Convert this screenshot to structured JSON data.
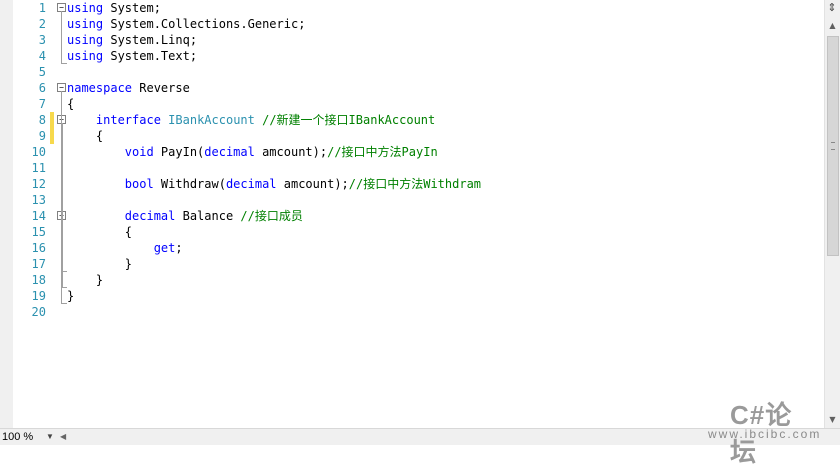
{
  "editor": {
    "lines": [
      {
        "num": "1",
        "parts": [
          {
            "t": "using",
            "c": "kw"
          },
          {
            "t": " System;",
            "c": ""
          }
        ]
      },
      {
        "num": "2",
        "parts": [
          {
            "t": "using",
            "c": "kw"
          },
          {
            "t": " System.Collections.Generic;",
            "c": ""
          }
        ]
      },
      {
        "num": "3",
        "parts": [
          {
            "t": "using",
            "c": "kw"
          },
          {
            "t": " System.Linq;",
            "c": ""
          }
        ]
      },
      {
        "num": "4",
        "parts": [
          {
            "t": "using",
            "c": "kw"
          },
          {
            "t": " System.Text;",
            "c": ""
          }
        ]
      },
      {
        "num": "5",
        "parts": []
      },
      {
        "num": "6",
        "parts": [
          {
            "t": "namespace",
            "c": "kw"
          },
          {
            "t": " Reverse",
            "c": ""
          }
        ]
      },
      {
        "num": "7",
        "parts": [
          {
            "t": "{",
            "c": ""
          }
        ]
      },
      {
        "num": "8",
        "parts": [
          {
            "t": "    ",
            "c": ""
          },
          {
            "t": "interface",
            "c": "kw"
          },
          {
            "t": " ",
            "c": ""
          },
          {
            "t": "IBankAccount",
            "c": "ty"
          },
          {
            "t": " //新建一个接口IBankAccount",
            "c": "cm"
          }
        ]
      },
      {
        "num": "9",
        "parts": [
          {
            "t": "    {",
            "c": ""
          }
        ]
      },
      {
        "num": "10",
        "parts": [
          {
            "t": "        ",
            "c": ""
          },
          {
            "t": "void",
            "c": "kw"
          },
          {
            "t": " PayIn(",
            "c": ""
          },
          {
            "t": "decimal",
            "c": "kw"
          },
          {
            "t": " amcount);",
            "c": ""
          },
          {
            "t": "//接口中方法PayIn",
            "c": "cm"
          }
        ]
      },
      {
        "num": "11",
        "parts": []
      },
      {
        "num": "12",
        "parts": [
          {
            "t": "        ",
            "c": ""
          },
          {
            "t": "bool",
            "c": "kw"
          },
          {
            "t": " Withdraw(",
            "c": ""
          },
          {
            "t": "decimal",
            "c": "kw"
          },
          {
            "t": " amcount);",
            "c": ""
          },
          {
            "t": "//接口中方法Withdram",
            "c": "cm"
          }
        ]
      },
      {
        "num": "13",
        "parts": []
      },
      {
        "num": "14",
        "parts": [
          {
            "t": "        ",
            "c": ""
          },
          {
            "t": "decimal",
            "c": "kw"
          },
          {
            "t": " Balance ",
            "c": ""
          },
          {
            "t": "//接口成员",
            "c": "cm"
          }
        ]
      },
      {
        "num": "15",
        "parts": [
          {
            "t": "        {",
            "c": ""
          }
        ]
      },
      {
        "num": "16",
        "parts": [
          {
            "t": "            ",
            "c": ""
          },
          {
            "t": "get",
            "c": "kw"
          },
          {
            "t": ";",
            "c": ""
          }
        ]
      },
      {
        "num": "17",
        "parts": [
          {
            "t": "        }",
            "c": ""
          }
        ]
      },
      {
        "num": "18",
        "parts": [
          {
            "t": "    }",
            "c": ""
          }
        ]
      },
      {
        "num": "19",
        "parts": [
          {
            "t": "}",
            "c": ""
          }
        ]
      },
      {
        "num": "20",
        "parts": []
      }
    ]
  },
  "status": {
    "zoom": "100 %"
  },
  "watermark": {
    "title": "C#论坛",
    "url": "www.ibcibc.com"
  },
  "colors": {
    "keyword": "#0000ff",
    "type": "#2b91af",
    "comment": "#008000",
    "line_number": "#2b91af",
    "change_marker": "#f7d94c"
  }
}
